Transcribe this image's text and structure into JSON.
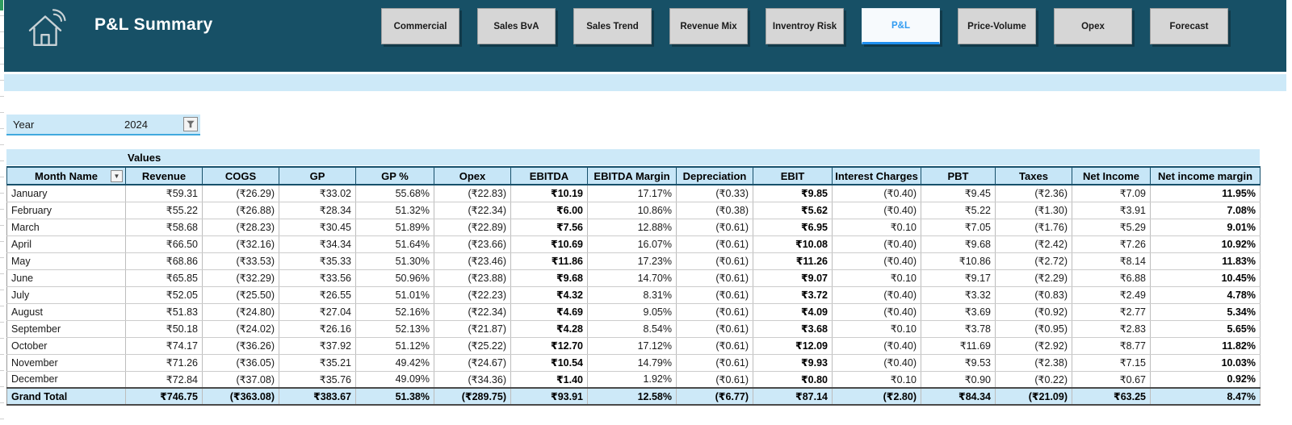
{
  "header": {
    "title": "P&L Summary"
  },
  "nav": {
    "buttons": [
      "Commercial",
      "Sales BvA",
      "Sales Trend",
      "Revenue Mix",
      "Inventroy Risk",
      "P&L",
      "Price-Volume",
      "Opex",
      "Forecast"
    ],
    "active": "P&L",
    "active_text_color": "#2f9bf1"
  },
  "filter": {
    "label": "Year",
    "value": "2024"
  },
  "table": {
    "group_header": "Values",
    "columns": [
      "Month Name",
      "Revenue",
      "COGS",
      "GP",
      "GP %",
      "Opex",
      "EBITDA",
      "EBITDA Margin",
      "Depreciation",
      "EBIT",
      "Interest Charges",
      "PBT",
      "Taxes",
      "Net Income",
      "Net income margin"
    ],
    "rows": [
      [
        "January",
        "₹59.31",
        "(₹26.29)",
        "₹33.02",
        "55.68%",
        "(₹22.83)",
        "₹10.19",
        "17.17%",
        "(₹0.33)",
        "₹9.85",
        "(₹0.40)",
        "₹9.45",
        "(₹2.36)",
        "₹7.09",
        "11.95%"
      ],
      [
        "February",
        "₹55.22",
        "(₹26.88)",
        "₹28.34",
        "51.32%",
        "(₹22.34)",
        "₹6.00",
        "10.86%",
        "(₹0.38)",
        "₹5.62",
        "(₹0.40)",
        "₹5.22",
        "(₹1.30)",
        "₹3.91",
        "7.08%"
      ],
      [
        "March",
        "₹58.68",
        "(₹28.23)",
        "₹30.45",
        "51.89%",
        "(₹22.89)",
        "₹7.56",
        "12.88%",
        "(₹0.61)",
        "₹6.95",
        "₹0.10",
        "₹7.05",
        "(₹1.76)",
        "₹5.29",
        "9.01%"
      ],
      [
        "April",
        "₹66.50",
        "(₹32.16)",
        "₹34.34",
        "51.64%",
        "(₹23.66)",
        "₹10.69",
        "16.07%",
        "(₹0.61)",
        "₹10.08",
        "(₹0.40)",
        "₹9.68",
        "(₹2.42)",
        "₹7.26",
        "10.92%"
      ],
      [
        "May",
        "₹68.86",
        "(₹33.53)",
        "₹35.33",
        "51.30%",
        "(₹23.46)",
        "₹11.86",
        "17.23%",
        "(₹0.61)",
        "₹11.26",
        "(₹0.40)",
        "₹10.86",
        "(₹2.72)",
        "₹8.14",
        "11.83%"
      ],
      [
        "June",
        "₹65.85",
        "(₹32.29)",
        "₹33.56",
        "50.96%",
        "(₹23.88)",
        "₹9.68",
        "14.70%",
        "(₹0.61)",
        "₹9.07",
        "₹0.10",
        "₹9.17",
        "(₹2.29)",
        "₹6.88",
        "10.45%"
      ],
      [
        "July",
        "₹52.05",
        "(₹25.50)",
        "₹26.55",
        "51.01%",
        "(₹22.23)",
        "₹4.32",
        "8.31%",
        "(₹0.61)",
        "₹3.72",
        "(₹0.40)",
        "₹3.32",
        "(₹0.83)",
        "₹2.49",
        "4.78%"
      ],
      [
        "August",
        "₹51.83",
        "(₹24.80)",
        "₹27.04",
        "52.16%",
        "(₹22.34)",
        "₹4.69",
        "9.05%",
        "(₹0.61)",
        "₹4.09",
        "(₹0.40)",
        "₹3.69",
        "(₹0.92)",
        "₹2.77",
        "5.34%"
      ],
      [
        "September",
        "₹50.18",
        "(₹24.02)",
        "₹26.16",
        "52.13%",
        "(₹21.87)",
        "₹4.28",
        "8.54%",
        "(₹0.61)",
        "₹3.68",
        "₹0.10",
        "₹3.78",
        "(₹0.95)",
        "₹2.83",
        "5.65%"
      ],
      [
        "October",
        "₹74.17",
        "(₹36.26)",
        "₹37.92",
        "51.12%",
        "(₹25.22)",
        "₹12.70",
        "17.12%",
        "(₹0.61)",
        "₹12.09",
        "(₹0.40)",
        "₹11.69",
        "(₹2.92)",
        "₹8.77",
        "11.82%"
      ],
      [
        "November",
        "₹71.26",
        "(₹36.05)",
        "₹35.21",
        "49.42%",
        "(₹24.67)",
        "₹10.54",
        "14.79%",
        "(₹0.61)",
        "₹9.93",
        "(₹0.40)",
        "₹9.53",
        "(₹2.38)",
        "₹7.15",
        "10.03%"
      ],
      [
        "December",
        "₹72.84",
        "(₹37.08)",
        "₹35.76",
        "49.09%",
        "(₹34.36)",
        "₹1.40",
        "1.92%",
        "(₹0.61)",
        "₹0.80",
        "₹0.10",
        "₹0.90",
        "(₹0.22)",
        "₹0.67",
        "0.92%"
      ]
    ],
    "grand_total": [
      "Grand Total",
      "₹746.75",
      "(₹363.08)",
      "₹383.67",
      "51.38%",
      "(₹289.75)",
      "₹93.91",
      "12.58%",
      "(₹6.77)",
      "₹87.14",
      "(₹2.80)",
      "₹84.34",
      "(₹21.09)",
      "₹63.25",
      "8.47%"
    ]
  },
  "colors": {
    "topbar_bg": "#175066",
    "band_bg": "#cde9f8",
    "table_header_bg": "#c7e6f7",
    "total_row_bg": "#cde9f8"
  }
}
